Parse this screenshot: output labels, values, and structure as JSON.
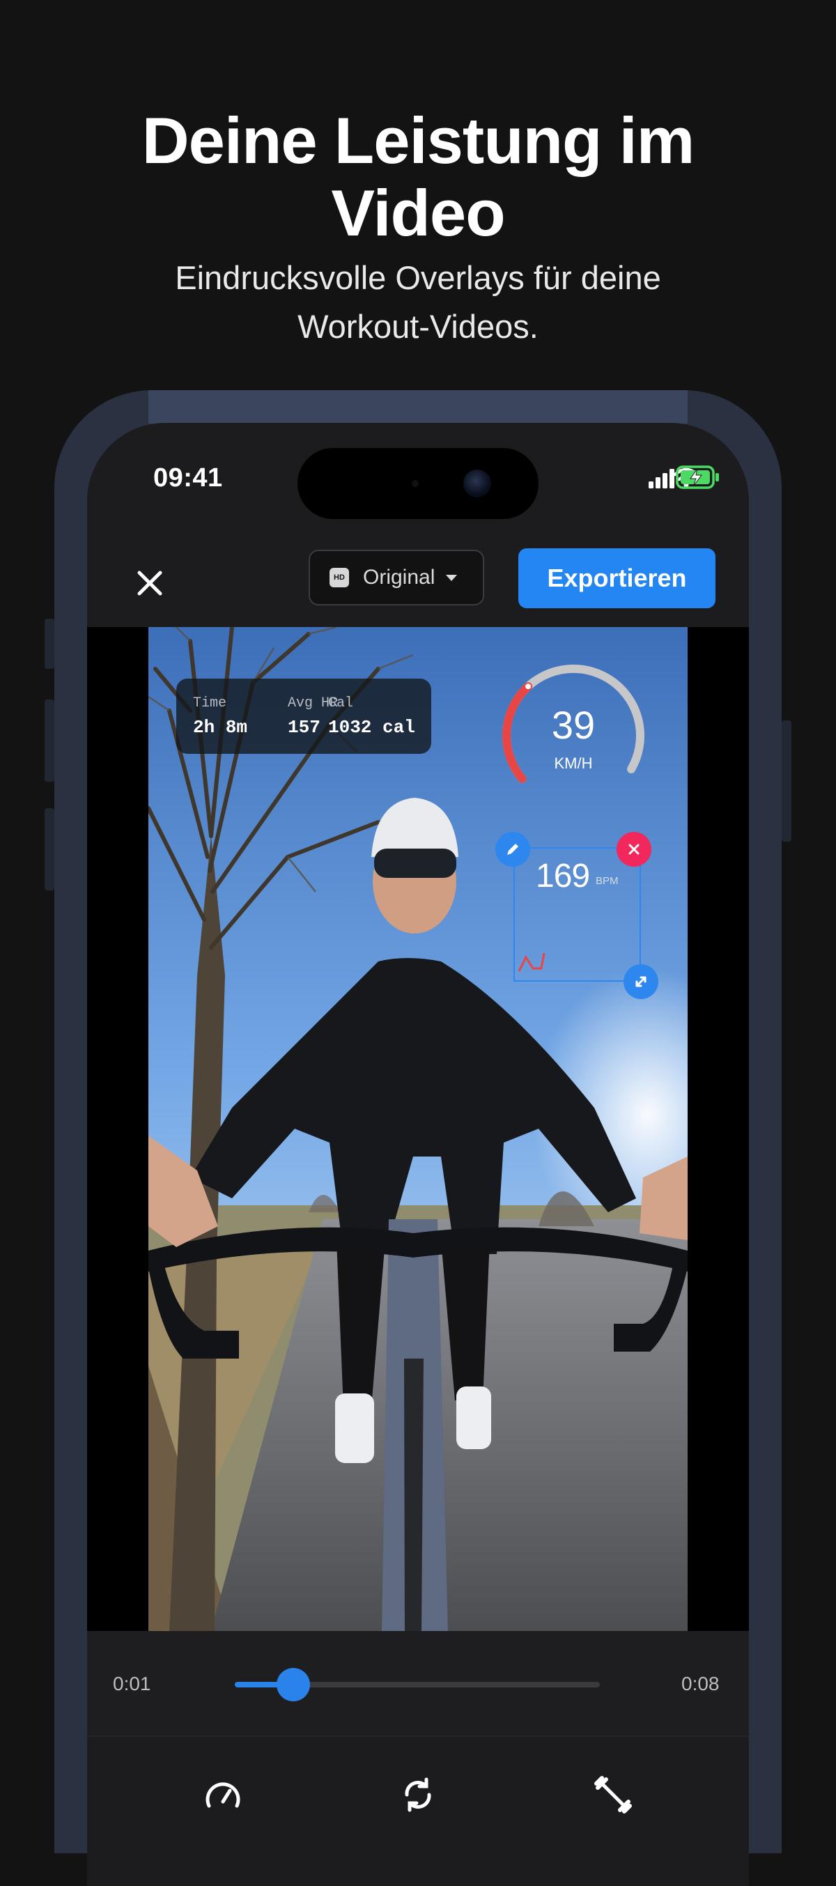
{
  "promo": {
    "headline_line1": "Deine Leistung im",
    "headline_line2": "Video",
    "subline_line1": "Eindrucksvolle Overlays für deine",
    "subline_line2": "Workout-Videos."
  },
  "status_bar": {
    "time": "09:41"
  },
  "editor": {
    "quality_badge": "HD",
    "quality_label": "Original",
    "export_label": "Exportieren"
  },
  "overlay": {
    "stats": [
      {
        "label": "Time",
        "value": "2h 8m"
      },
      {
        "label": "Avg HR",
        "value": "157"
      },
      {
        "label": "Cal",
        "value": "1032 cal"
      }
    ],
    "speed": {
      "value": "39",
      "unit": "KM/H",
      "level": 0.35
    },
    "heart_rate": {
      "value": "169",
      "unit": "BPM"
    }
  },
  "timeline": {
    "current": "0:01",
    "total": "0:08",
    "progress": 0.16
  },
  "icons": {
    "close": "close-icon",
    "speed_tool": "speedometer-icon",
    "repeat_tool": "repeat-icon",
    "workout_tool": "dumbbell-icon"
  },
  "colors": {
    "accent": "#2386f2",
    "delete": "#f2275b",
    "gauge_active": "#e84545"
  }
}
